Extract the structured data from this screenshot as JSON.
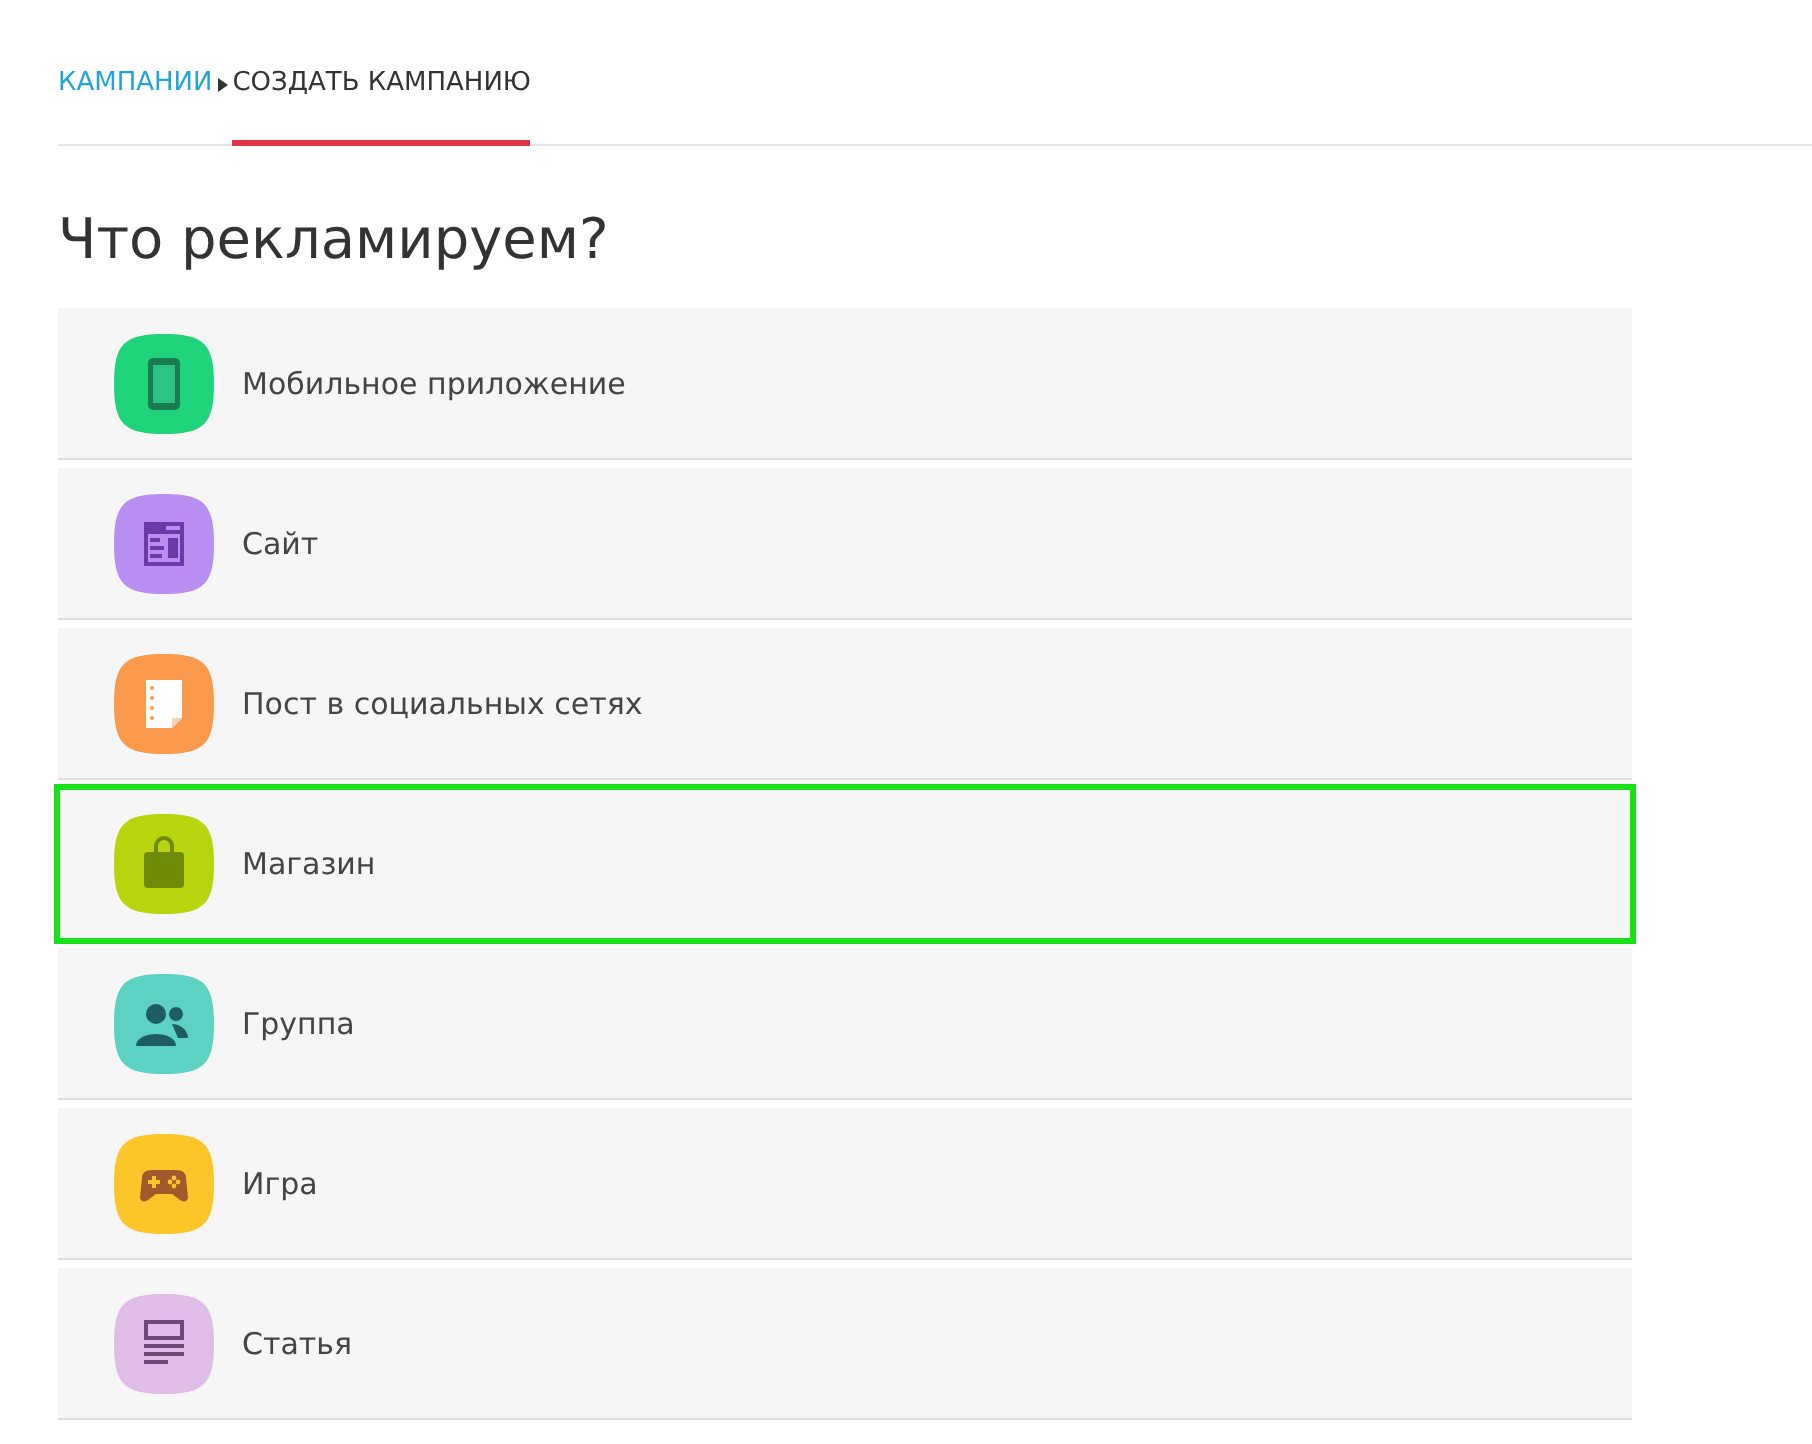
{
  "breadcrumbs": [
    {
      "label": "КАМПАНИИ",
      "selected": false
    },
    {
      "label": "СОЗДАТЬ КАМПАНИЮ",
      "selected": true
    }
  ],
  "heading": "Что рекламируем?",
  "options": [
    {
      "label": "Мобильное приложение",
      "kind": "phone",
      "color": "#1ed37a",
      "selected": false
    },
    {
      "label": "Сайт",
      "kind": "site",
      "color": "#b98ef2",
      "selected": false
    },
    {
      "label": "Пост в социальных сетях",
      "kind": "post",
      "color": "#fb9a4c",
      "selected": false
    },
    {
      "label": "Магазин",
      "kind": "bag",
      "color": "#b7d40e",
      "selected": true
    },
    {
      "label": "Группа",
      "kind": "group",
      "color": "#5dd2c3",
      "selected": false
    },
    {
      "label": "Игра",
      "kind": "game",
      "color": "#fcc62a",
      "selected": false
    },
    {
      "label": "Статья",
      "kind": "article",
      "color": "#dfbde6",
      "selected": false
    }
  ]
}
